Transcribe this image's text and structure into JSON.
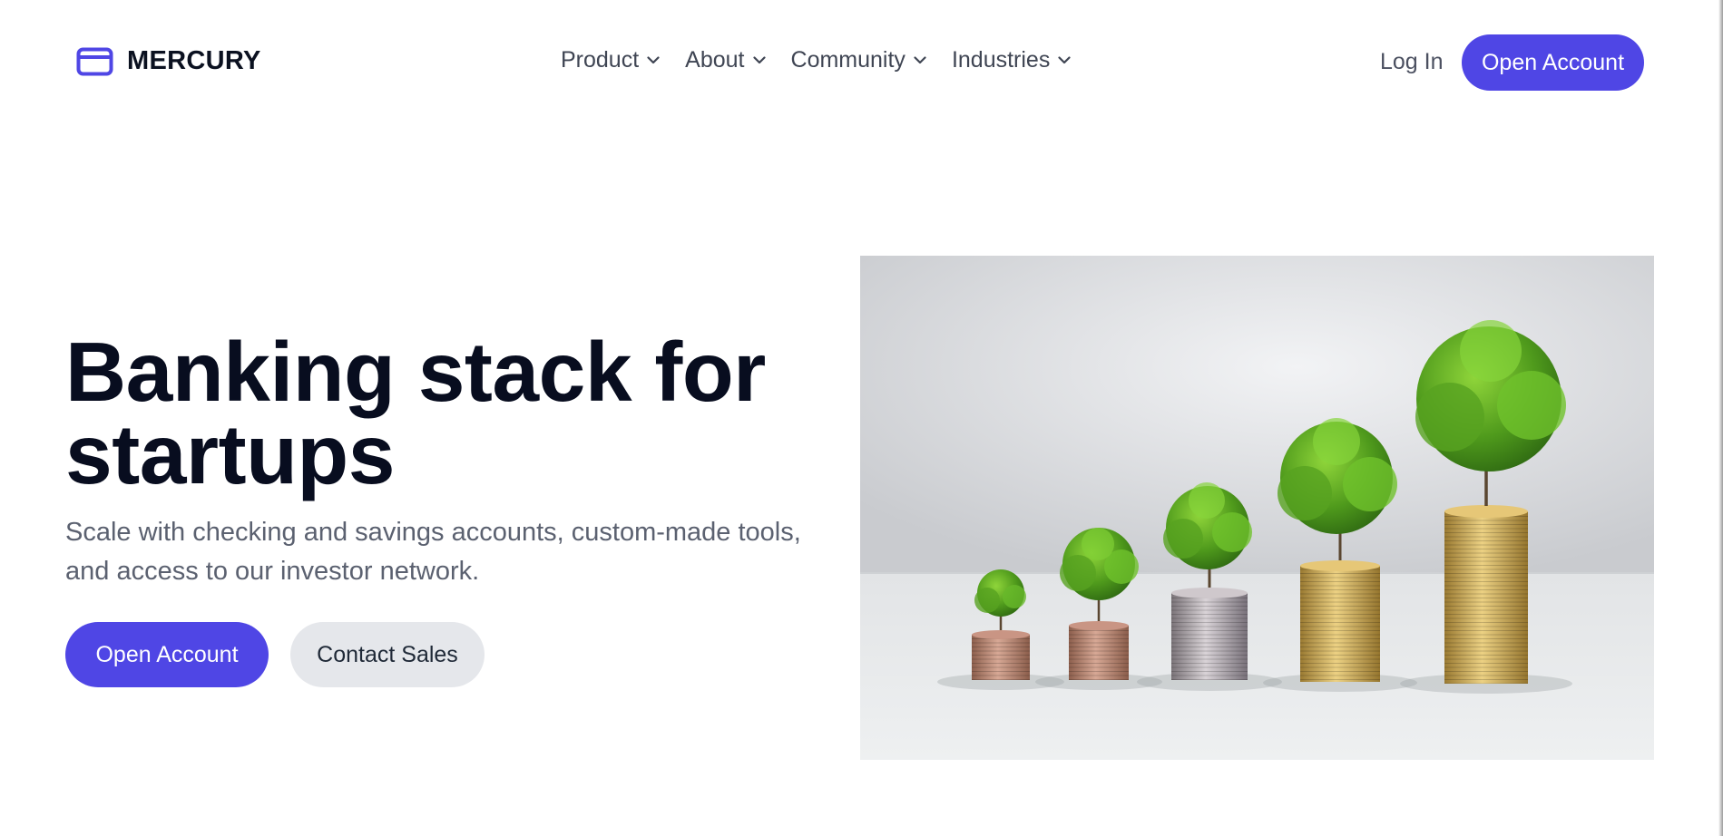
{
  "header": {
    "brand_name": "MERCURY",
    "brand_icon": "credit-card-icon",
    "nav": [
      {
        "label": "Product",
        "icon": "chevron-down-icon"
      },
      {
        "label": "About",
        "icon": "chevron-down-icon"
      },
      {
        "label": "Community",
        "icon": "chevron-down-icon"
      },
      {
        "label": "Industries",
        "icon": "chevron-down-icon"
      }
    ],
    "login_label": "Log In",
    "cta_label": "Open Account"
  },
  "hero": {
    "title": "Banking stack for startups",
    "subtitle": "Scale with checking and savings accounts, custom-made tools, and access to our investor network.",
    "primary_label": "Open Account",
    "secondary_label": "Contact Sales"
  },
  "colors": {
    "accent": "#4f46e5",
    "heading": "#080d1f",
    "secondary_button_bg": "#e5e7eb"
  }
}
